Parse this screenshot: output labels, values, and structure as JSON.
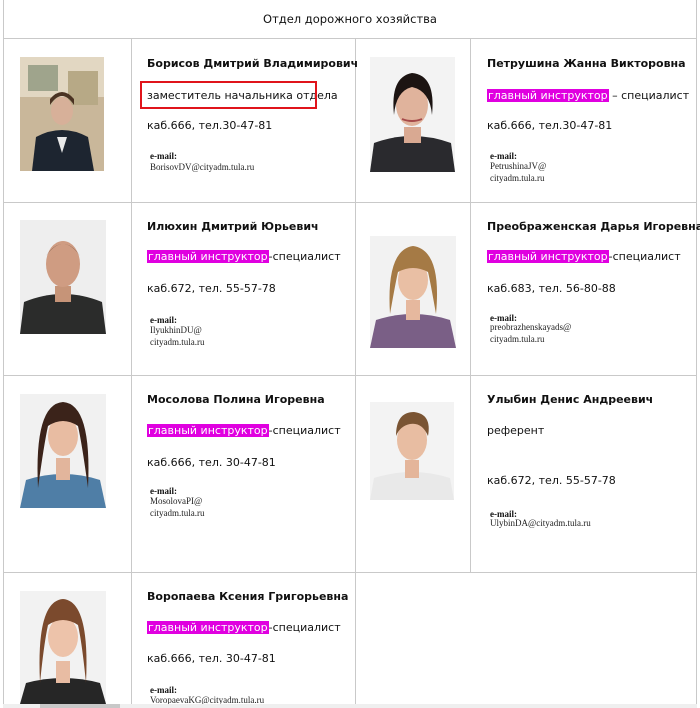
{
  "title": "Отдел дорожного хозяйства",
  "staff": [
    {
      "name": "Борисов Дмитрий Владимирович",
      "role_hl": "",
      "role_rest": "заместитель начальника отдела",
      "room": "каб.666, тел.30-47-81",
      "email_label": "e-mail:",
      "email_l1": "BorisovDV@cityadm.tula.ru",
      "email_l2": ""
    },
    {
      "name": "Петрушина Жанна Викторовна",
      "role_hl": "главный инструктор",
      "role_rest": " – специалист",
      "room": "каб.666, тел.30-47-81",
      "email_label": "e-mail:",
      "email_l1": "PetrushinaJV@",
      "email_l2": "cityadm.tula.ru"
    },
    {
      "name": "Илюхин Дмитрий Юрьевич",
      "role_hl": "главный инструктор",
      "role_rest": "-специалист",
      "room": "каб.672, тел. 55-57-78",
      "email_label": "e-mail:",
      "email_l1": "IlyukhinDU@",
      "email_l2": "cityadm.tula.ru"
    },
    {
      "name": "Преображенская Дарья Игоревна",
      "role_hl": "главный инструктор",
      "role_rest": "-специалист",
      "room": "каб.683, тел. 56-80-88",
      "email_label": "e-mail:",
      "email_l1": "preobrazhenskayads@",
      "email_l2": "cityadm.tula.ru"
    },
    {
      "name": "Мосолова Полина Игоревна",
      "role_hl": "главный инструктор",
      "role_rest": "-специалист",
      "room": "каб.666, тел. 30-47-81",
      "email_label": "e-mail:",
      "email_l1": "MosolovaPI@",
      "email_l2": "cityadm.tula.ru"
    },
    {
      "name": "Улыбин Денис Андреевич",
      "role_hl": "",
      "role_rest": "референт",
      "room": "каб.672, тел. 55-57-78",
      "email_label": "e-mail:",
      "email_l1": "UlybinDA@cityadm.tula.ru",
      "email_l2": ""
    },
    {
      "name": "Воропаева Ксения Григорьевна",
      "role_hl": "главный инструктор",
      "role_rest": "-специалист",
      "room": "каб.666, тел. 30-47-81",
      "email_label": "e-mail:",
      "email_l1": "VoropaevaKG@cityadm.tula.ru",
      "email_l2": ""
    }
  ],
  "colors": {
    "highlight": "#e000e0",
    "annotation_box": "#e0141b",
    "grid": "#c9c9c9"
  }
}
